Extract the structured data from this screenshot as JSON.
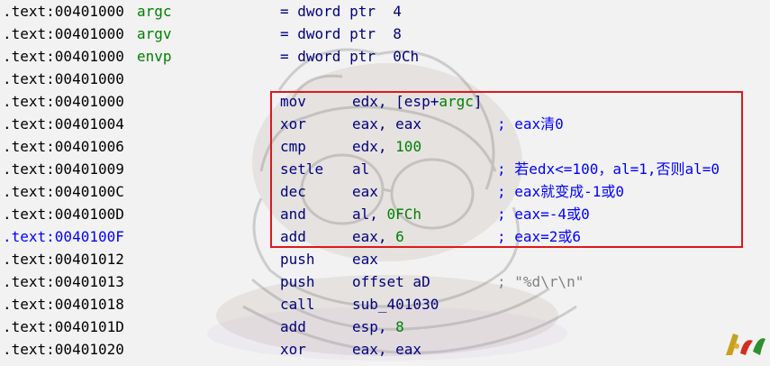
{
  "listing": {
    "rows": [
      {
        "addr": ".text:00401000",
        "label": "argc",
        "text": "= dword ptr  4"
      },
      {
        "addr": ".text:00401000",
        "label": "argv",
        "text": "= dword ptr  8"
      },
      {
        "addr": ".text:00401000",
        "label": "envp",
        "text": "= dword ptr  0Ch"
      },
      {
        "addr": ".text:00401000"
      },
      {
        "addr": ".text:00401000",
        "mnemonic": "mov",
        "operands": [
          "edx, [esp+",
          "argc",
          "]"
        ]
      },
      {
        "addr": ".text:00401004",
        "mnemonic": "xor",
        "operands": [
          "eax, eax"
        ],
        "comment": "; eax清0"
      },
      {
        "addr": ".text:00401006",
        "mnemonic": "cmp",
        "operands": [
          "edx, ",
          "100"
        ]
      },
      {
        "addr": ".text:00401009",
        "mnemonic": "setle",
        "operands": [
          "al"
        ],
        "comment": "; 若edx<=100，al=1,否则al=0"
      },
      {
        "addr": ".text:0040100C",
        "mnemonic": "dec",
        "operands": [
          "eax"
        ],
        "comment": "; eax就变成-1或0"
      },
      {
        "addr": ".text:0040100D",
        "mnemonic": "and",
        "operands": [
          "al, ",
          "0FCh"
        ],
        "comment": "; eax=-4或0"
      },
      {
        "addr": ".text:0040100F",
        "mnemonic": "add",
        "operands": [
          "eax, ",
          "6"
        ],
        "comment": "; eax=2或6",
        "selected": true
      },
      {
        "addr": ".text:00401012",
        "mnemonic": "push",
        "operands": [
          "eax"
        ]
      },
      {
        "addr": ".text:00401013",
        "mnemonic": "push",
        "operands": [
          "offset aD"
        ],
        "comment": "; \"%d\\r\\n\"",
        "comment_gray": true
      },
      {
        "addr": ".text:00401018",
        "mnemonic": "call",
        "operands": [
          "sub_401030"
        ]
      },
      {
        "addr": ".text:0040101D",
        "mnemonic": "add",
        "operands": [
          "esp, ",
          "8"
        ]
      },
      {
        "addr": ".text:00401020",
        "mnemonic": "xor",
        "operands": [
          "eax, eax"
        ]
      }
    ]
  },
  "colors": {
    "background": "#f2f2f2",
    "address": "#000000",
    "selected_address": "#0000ff",
    "label": "#008000",
    "instruction": "#000080",
    "number": "#008000",
    "comment": "#0000ff",
    "string_comment": "#808080",
    "highlight_box": "#e01818"
  },
  "icons": {
    "watermark": "cartoon-character-watermark",
    "corner_logo": "leaf-logo-icon"
  }
}
